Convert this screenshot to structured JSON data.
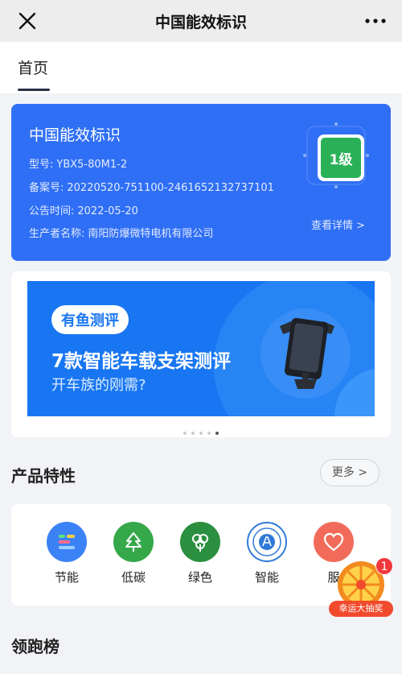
{
  "header": {
    "title": "中国能效标识",
    "close_icon": "close-icon",
    "more_icon": "more-dots-icon"
  },
  "tabs": [
    {
      "label": "首页",
      "active": true
    }
  ],
  "label_card": {
    "title": "中国能效标识",
    "model_label": "型号:",
    "model_value": "YBX5-80M1-2",
    "record_label": "备案号:",
    "record_value": "20220520-751100-2461652132737101",
    "date_label": "公告时间:",
    "date_value": "2022-05-20",
    "producer_label": "生产者名称:",
    "producer_value": "南阳防爆微特电机有限公司",
    "grade": "1级",
    "details_link": "查看详情 >",
    "colors": {
      "card": "#2f6ff5",
      "grade": "#2ab157"
    }
  },
  "banner": {
    "tag": "有鱼测评",
    "headline": "7款智能车载支架测评",
    "subline": "开车族的刚需?",
    "slides": 5,
    "active_slide": 5
  },
  "features": {
    "title": "产品特性",
    "more_label": "更多 >",
    "items": [
      {
        "label": "节能",
        "icon": "energy-saving-icon",
        "color": "#3b82f6"
      },
      {
        "label": "低碳",
        "icon": "low-carbon-tree-icon",
        "color": "#35a84a"
      },
      {
        "label": "绿色",
        "icon": "green-leaf-icon",
        "color": "#2a8f3e"
      },
      {
        "label": "智能",
        "icon": "ai-smart-icon",
        "color": "#2f7ad8"
      },
      {
        "label": "服",
        "icon": "heart-icon",
        "color": "#f26b5a"
      }
    ]
  },
  "lottery": {
    "badge": "1",
    "label": "幸运大抽奖"
  },
  "ranking": {
    "title": "领跑榜"
  }
}
